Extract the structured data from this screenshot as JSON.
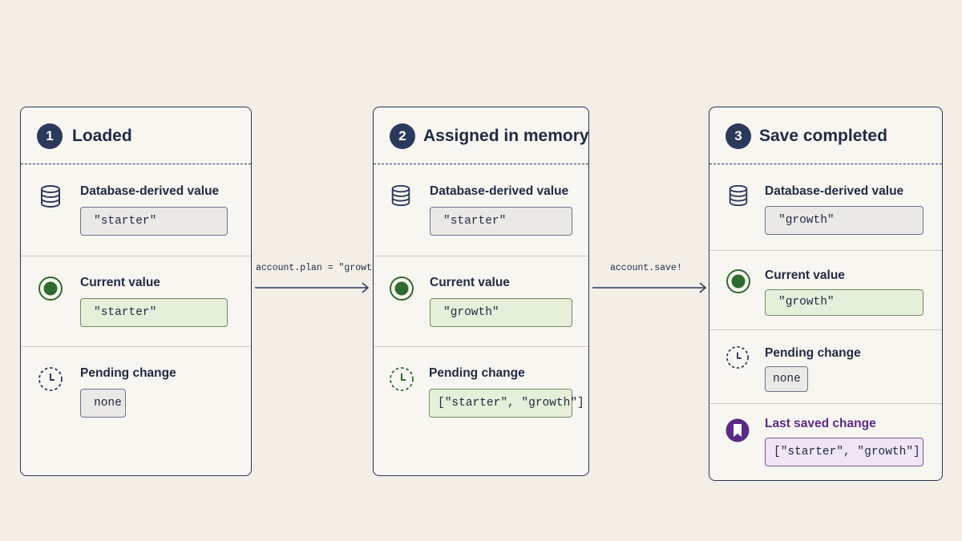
{
  "colors": {
    "background": "#f3efe7",
    "navy": "#2b3a5c",
    "green": "#2e6b2e",
    "purple": "#5b2a86"
  },
  "steps": [
    {
      "number": "1",
      "title": "Loaded",
      "sections": [
        {
          "icon": "database-icon",
          "label": "Database-derived value",
          "value": "\"starter\"",
          "style": "grey"
        },
        {
          "icon": "radio-dot-icon",
          "label": "Current value",
          "value": "\"starter\"",
          "style": "green"
        },
        {
          "icon": "clock-icon",
          "label": "Pending change",
          "value": "none",
          "style": "grey"
        }
      ]
    },
    {
      "number": "2",
      "title": "Assigned in memory",
      "sections": [
        {
          "icon": "database-icon",
          "label": "Database-derived value",
          "value": "\"starter\"",
          "style": "grey"
        },
        {
          "icon": "radio-dot-icon",
          "label": "Current value",
          "value": "\"growth\"",
          "style": "green"
        },
        {
          "icon": "clock-icon",
          "label": "Pending change",
          "value": "[\"starter\", \"growth\"]",
          "style": "green"
        }
      ]
    },
    {
      "number": "3",
      "title": "Save completed",
      "sections": [
        {
          "icon": "database-icon",
          "label": "Database-derived value",
          "value": "\"growth\"",
          "style": "grey"
        },
        {
          "icon": "radio-dot-icon",
          "label": "Current value",
          "value": "\"growth\"",
          "style": "green"
        },
        {
          "icon": "clock-icon",
          "label": "Pending change",
          "value": "none",
          "style": "grey"
        },
        {
          "icon": "bookmark-icon",
          "label": "Last saved change",
          "value": "[\"starter\", \"growth\"]",
          "style": "purple"
        }
      ]
    }
  ],
  "transitions": [
    {
      "label": "account.plan = \"growth\""
    },
    {
      "label": "account.save!"
    }
  ]
}
